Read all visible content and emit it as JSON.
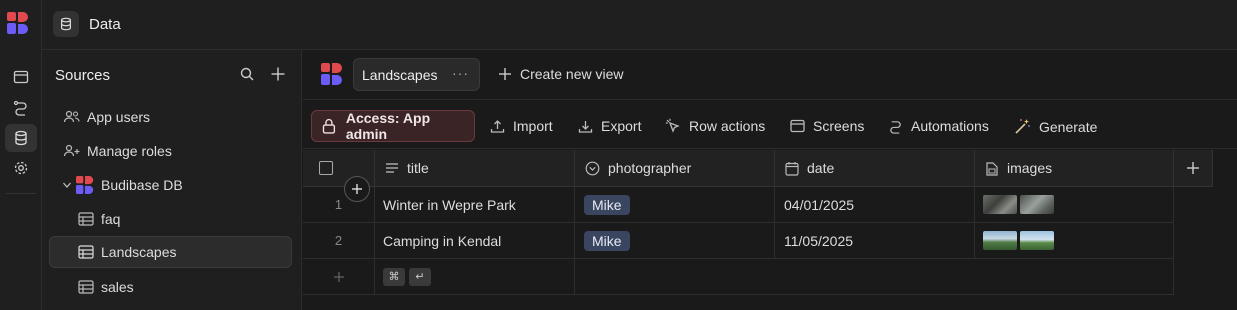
{
  "topbar": {
    "title": "Data"
  },
  "sources": {
    "heading": "Sources",
    "items": [
      {
        "label": "App users",
        "icon": "users-icon"
      },
      {
        "label": "Manage roles",
        "icon": "user-plus-icon"
      },
      {
        "label": "Budibase DB",
        "icon": "budibase-logo-icon"
      },
      {
        "label": "faq",
        "icon": "table-icon"
      },
      {
        "label": "Landscapes",
        "icon": "table-icon",
        "active": true
      },
      {
        "label": "sales",
        "icon": "table-icon"
      }
    ]
  },
  "viewbar": {
    "tab_label": "Landscapes",
    "tab_menu": "···",
    "create_label": "Create new view"
  },
  "toolbar": {
    "access_label": "Access: App admin",
    "import_label": "Import",
    "export_label": "Export",
    "row_actions_label": "Row actions",
    "screens_label": "Screens",
    "automations_label": "Automations",
    "generate_label": "Generate"
  },
  "table": {
    "columns": [
      "title",
      "photographer",
      "date",
      "images"
    ],
    "rows": [
      {
        "num": "1",
        "title": "Winter in Wepre Park",
        "photographer": "Mike",
        "date": "04/01/2025"
      },
      {
        "num": "2",
        "title": "Camping in Kendal",
        "photographer": "Mike",
        "date": "11/05/2025"
      }
    ],
    "new_row_keys": [
      "⌘",
      "↵"
    ]
  },
  "colors": {
    "accent_red": "#e04a4f",
    "accent_purple": "#6b5cf5",
    "access_bg": "#3a2426",
    "pill_bg": "#3a4560"
  }
}
